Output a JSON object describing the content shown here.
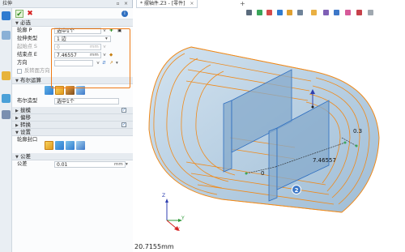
{
  "dock": {
    "title": "拉伸",
    "section_required": "必选",
    "contour_label": "轮廓 P",
    "contour_value": "选中1个",
    "extrude_type_label": "拉伸类型",
    "extrude_type_value": "1 边",
    "start_label": "起始点 S",
    "start_value": "0",
    "start_unit": "mm",
    "end_label": "结束点 E",
    "end_value": "7.46557",
    "end_unit": "mm",
    "direction_label": "方向",
    "reverse_label": "反转面方向",
    "section_boolean": "布尔运算",
    "boolean_shape_label": "布尔造型",
    "boolean_shape_value": "选中1个",
    "section_draft": "拔模",
    "section_offset": "偏移",
    "section_twist": "转换",
    "section_settings": "设置",
    "contour_seal_label": "轮廓封口",
    "section_tolerance": "公差",
    "tolerance_label": "公差",
    "tolerance_value": "0.01",
    "tolerance_unit": "mm",
    "callout_3": "3"
  },
  "viewport": {
    "doc_tab": "* 摆轴件.Z3 - [零件]",
    "status_value": "20.7155mm",
    "dim_03": "0.3",
    "dim_746": "7.46557",
    "dim_0": "0",
    "callout_2": "2",
    "axis_x": "X",
    "axis_y": "Y",
    "axis_z": "Z"
  },
  "colors": {
    "accent": "#ef7a16",
    "callout": "#3d78c8",
    "part_fill": "#bcd3e6",
    "part_edge": "#f08a1a"
  }
}
